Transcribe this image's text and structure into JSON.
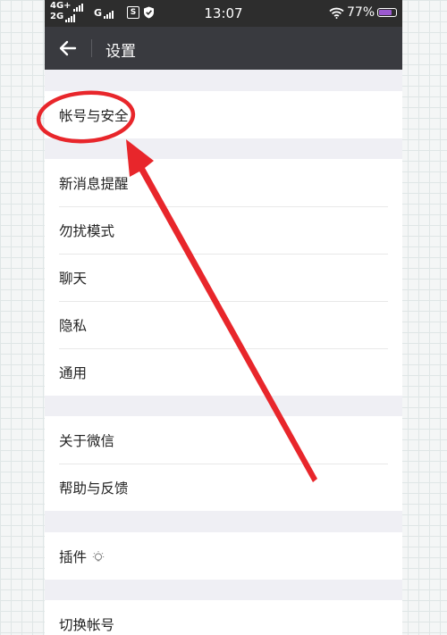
{
  "status_bar": {
    "network_1": "4G+",
    "network_2": "2G",
    "network_3": "G",
    "s_badge": "S",
    "time": "13:07",
    "battery_percent": "77%",
    "battery_level": 0.77,
    "battery_color": "#9b59d0"
  },
  "title_bar": {
    "back_icon": "arrow-left-icon",
    "title": "设置"
  },
  "groups": {
    "account": {
      "items": [
        {
          "label": "帐号与安全"
        }
      ]
    },
    "general": {
      "items": [
        {
          "label": "新消息提醒"
        },
        {
          "label": "勿扰模式"
        },
        {
          "label": "聊天"
        },
        {
          "label": "隐私"
        },
        {
          "label": "通用"
        }
      ]
    },
    "about": {
      "items": [
        {
          "label": "关于微信"
        },
        {
          "label": "帮助与反馈"
        }
      ]
    },
    "plugins": {
      "items": [
        {
          "label": "插件",
          "icon": "lightbulb-icon"
        }
      ]
    },
    "switch": {
      "items": [
        {
          "label": "切换帐号"
        }
      ]
    }
  },
  "annotation": {
    "color": "#e8262b",
    "icons": [
      "highlight-ellipse",
      "pointer-arrow"
    ]
  }
}
